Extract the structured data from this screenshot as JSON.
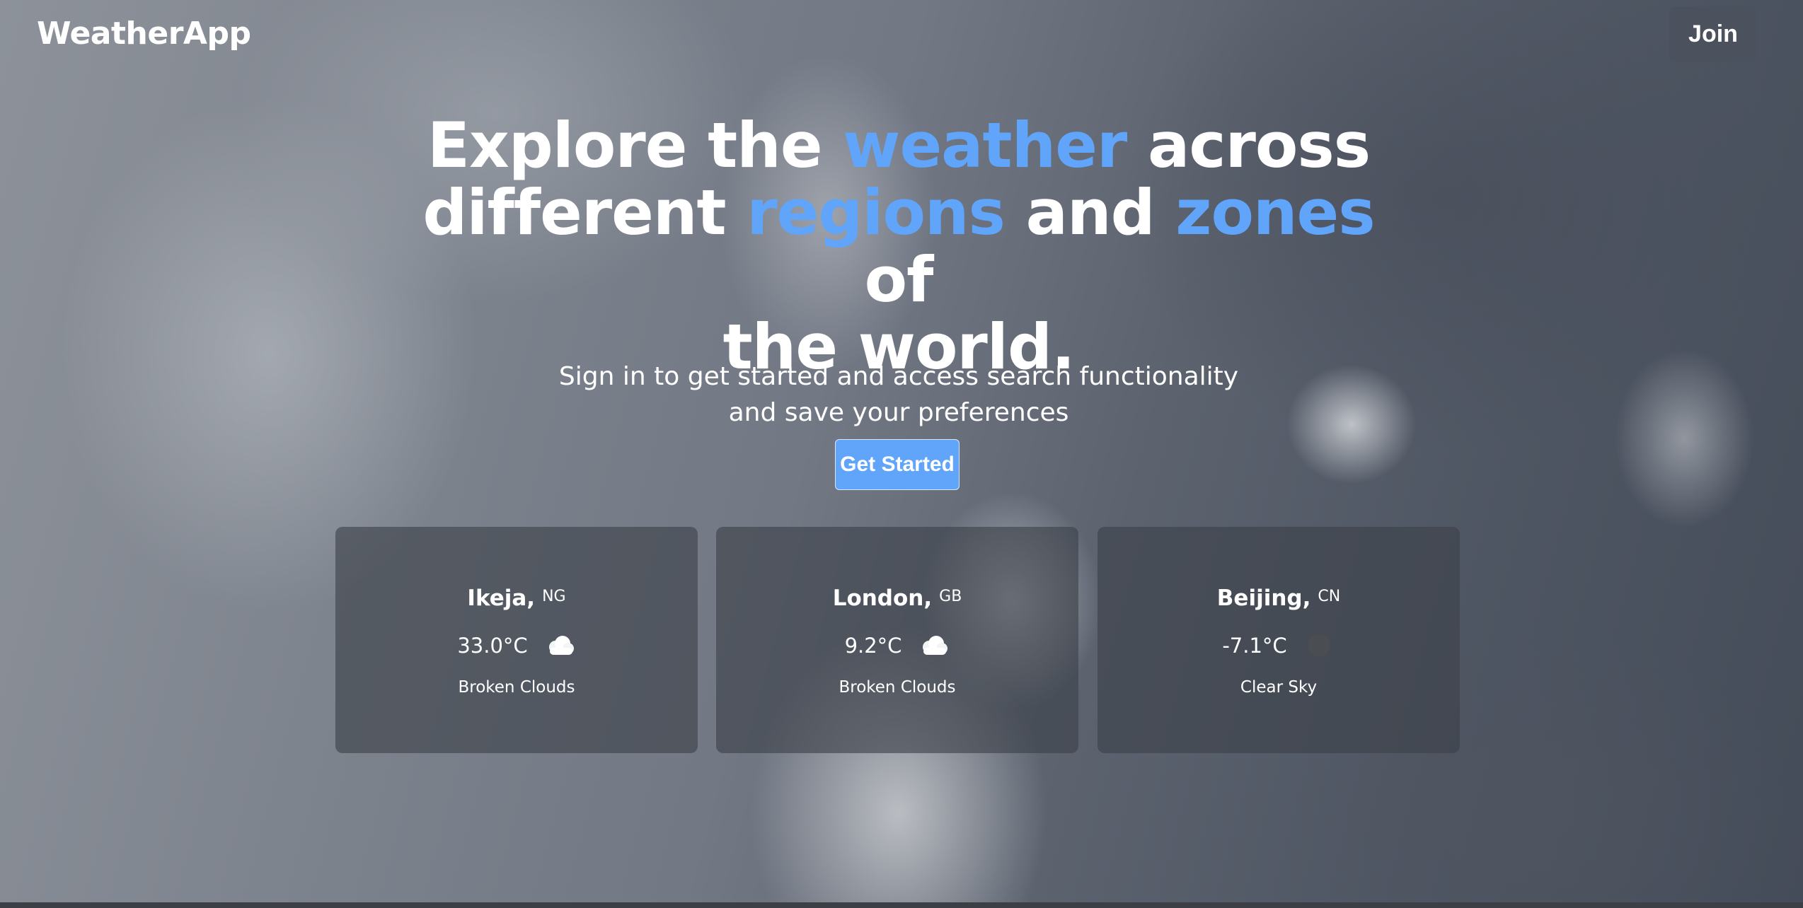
{
  "nav": {
    "logo": "WeatherApp",
    "join_label": "Join"
  },
  "hero": {
    "title_parts": [
      "Explore the ",
      "weather",
      " across",
      "different ",
      "regions",
      " and ",
      "zones",
      " of",
      "the world."
    ],
    "subtitle_line1": "Sign in to get started and access search functionality",
    "subtitle_line2": "and save your preferences",
    "cta_label": "Get Started",
    "accent_color": "#60a5fa"
  },
  "cards": [
    {
      "city": "Ikeja,",
      "country": "NG",
      "temperature": "33.0°C",
      "icon": "broken-clouds-icon",
      "description": "Broken Clouds"
    },
    {
      "city": "London,",
      "country": "GB",
      "temperature": "9.2°C",
      "icon": "broken-clouds-icon",
      "description": "Broken Clouds"
    },
    {
      "city": "Beijing,",
      "country": "CN",
      "temperature": "-7.1°C",
      "icon": "clear-sky-icon",
      "description": "Clear Sky"
    }
  ]
}
